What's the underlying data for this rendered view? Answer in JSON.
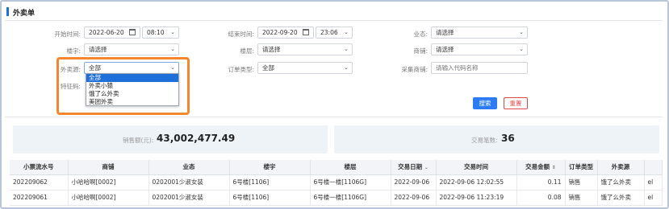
{
  "header": {
    "title": "外卖单"
  },
  "filters": {
    "start_time_label": "开始时间:",
    "start_date": "2022-06-20",
    "start_hour": "08:10",
    "end_time_label": "结束时间:",
    "end_date": "2022-09-20",
    "end_hour": "23:06",
    "business_label": "业态:",
    "business_value": "请选择",
    "building_label": "楼宇:",
    "building_value": "请选择",
    "floor_label": "楼层:",
    "floor_value": "请选择",
    "shop_label": "商铺:",
    "shop_value": "请选择",
    "source_label": "外卖源:",
    "source_value": "全部",
    "order_type_label": "订单类型:",
    "order_type_value": "全部",
    "collect_shop_label": "采集商铺:",
    "collect_shop_placeholder": "请输入代码名称",
    "special_code_label": "特征码:"
  },
  "source_dropdown": {
    "options": [
      "全部",
      "外卖小猿",
      "饿了么外卖",
      "美团外卖"
    ],
    "selected_index": 0
  },
  "buttons": {
    "search": "搜索",
    "reset": "重置"
  },
  "stats": {
    "sales_label": "销售额(元):",
    "sales_value": "43,002,477.49",
    "count_label": "交易笔数:",
    "count_value": "36"
  },
  "table": {
    "columns": [
      "小票流水号",
      "商铺",
      "业态",
      "楼宇",
      "楼层",
      "交易日期",
      "交易时间",
      "交易金额",
      "订单类型",
      "外卖源",
      ""
    ],
    "rows": [
      [
        "202209062",
        "小哈哈啊[0002]",
        "0202001少淑女装",
        "6号楼[1106]",
        "6号楼一楼[1106G]",
        "2022-09-06",
        "2022-09-06 12:02:55",
        "0.11",
        "销售",
        "饿了么外卖",
        "el"
      ],
      [
        "202209061",
        "小哈哈啊[0002]",
        "0202001少淑女装",
        "6号楼[1106]",
        "6号楼一楼[1106G]",
        "2022-09-06",
        "2022-09-06 11:23:19",
        "0.08",
        "销售",
        "饿了么外卖",
        "el"
      ]
    ]
  }
}
